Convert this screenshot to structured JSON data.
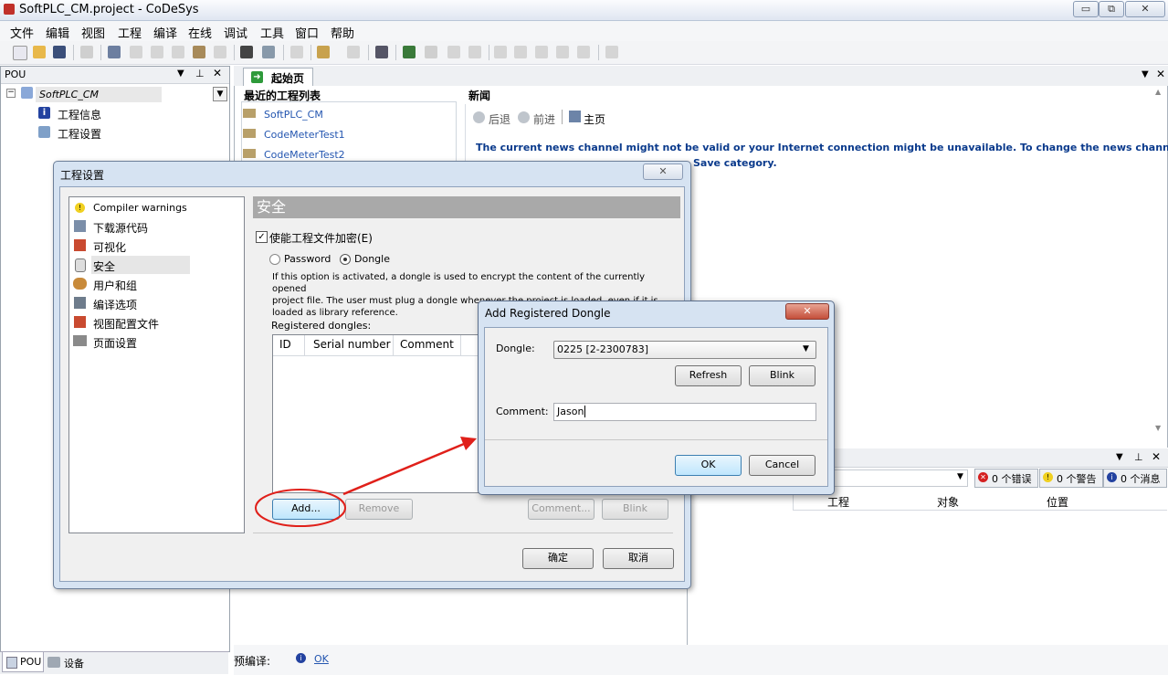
{
  "window": {
    "title": "SoftPLC_CM.project - CoDeSys",
    "minimize": "▭",
    "restore": "⧉",
    "close": "✕"
  },
  "menu": [
    "文件",
    "编辑",
    "视图",
    "工程",
    "编译",
    "在线",
    "调试",
    "工具",
    "窗口",
    "帮助"
  ],
  "pou_panel": {
    "title": "POU",
    "project": "SoftPLC_CM",
    "items": [
      {
        "label": "工程信息",
        "icon": "info-icon"
      },
      {
        "label": "工程设置",
        "icon": "settings-doc-icon"
      }
    ],
    "tabs": [
      {
        "label": "POU"
      },
      {
        "label": "设备"
      }
    ]
  },
  "editor": {
    "tab_label": "起始页",
    "recent_title": "最近的工程列表",
    "recent_projects": [
      "SoftPLC_CM",
      "CodeMeterTest1",
      "CodeMeterTest2"
    ],
    "news_title": "新闻",
    "nav": {
      "back": "后退",
      "forward": "前进",
      "home": "主页"
    },
    "news_text_line1": "The current news channel might not be valid or your Internet connection might be unavailable. To change the news channel, go",
    "news_text_line2": "Save category."
  },
  "messages": {
    "errors": "0 个错误",
    "warnings": "0 个警告",
    "infos": "0 个消息",
    "columns": [
      "工程",
      "对象",
      "位置"
    ]
  },
  "status": {
    "label": "预编译:",
    "value": "OK"
  },
  "project_settings_dialog": {
    "title": "工程设置",
    "close": "✕",
    "nav": [
      {
        "label": "Compiler warnings",
        "icon": "warning-icon"
      },
      {
        "label": "下载源代码",
        "icon": "download-icon"
      },
      {
        "label": "可视化",
        "icon": "visualization-icon"
      },
      {
        "label": "安全",
        "icon": "lock-icon"
      },
      {
        "label": "用户和组",
        "icon": "users-icon"
      },
      {
        "label": "编译选项",
        "icon": "compile-icon"
      },
      {
        "label": "视图配置文件",
        "icon": "view-profile-icon"
      },
      {
        "label": "页面设置",
        "icon": "printer-icon"
      }
    ],
    "selected": "安全",
    "section_title": "安全",
    "enable_encryption": {
      "label": "使能工程文件加密(E)",
      "checked": true
    },
    "radio_password": "Password",
    "radio_dongle": "Dongle",
    "selected_mode": "Dongle",
    "description_lines": [
      "If this option is activated, a dongle is used to encrypt the content of the currently opened",
      "project file. The user must plug a dongle whenever the project is loaded, even if it is",
      "loaded as library reference."
    ],
    "registered_label": "Registered dongles:",
    "table_columns": [
      "ID",
      "Serial number",
      "Comment"
    ],
    "buttons": {
      "add": "Add...",
      "remove": "Remove",
      "comment": "Comment...",
      "blink": "Blink",
      "ok": "确定",
      "cancel": "取消"
    }
  },
  "add_dongle_dialog": {
    "title": "Add Registered Dongle",
    "close": "✕",
    "dongle_label": "Dongle:",
    "dongle_value": "0225 [2-2300783]",
    "refresh": "Refresh",
    "blink": "Blink",
    "comment_label": "Comment:",
    "comment_value": "Jason",
    "ok": "OK",
    "cancel": "Cancel"
  },
  "colors": {
    "accent": "#0a3a8c",
    "highlight_red": "#e0201a",
    "section_header": "#a9a9a9"
  }
}
